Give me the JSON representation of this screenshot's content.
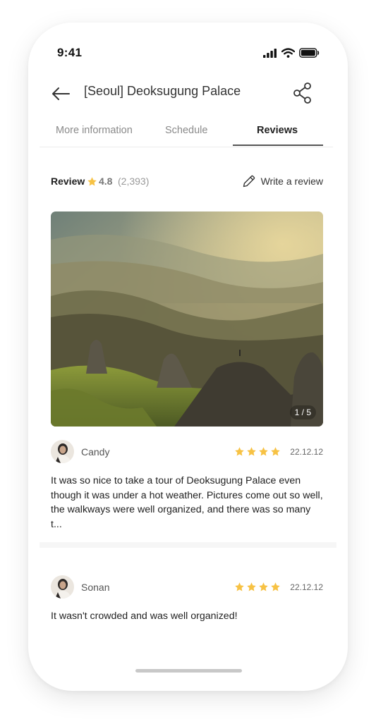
{
  "status_bar": {
    "time": "9:41"
  },
  "header": {
    "title": "[Seoul] Deoksugung Palace"
  },
  "tabs": [
    {
      "label": "More information",
      "active": false
    },
    {
      "label": "Schedule",
      "active": false
    },
    {
      "label": "Reviews",
      "active": true
    }
  ],
  "review_summary": {
    "label": "Review",
    "score": "4.8",
    "count": "(2,393)",
    "write_label": "Write a review"
  },
  "photo": {
    "counter": "1 / 5"
  },
  "reviews": [
    {
      "name": "Candy",
      "rating": 4,
      "date": "22.12.12",
      "text": "It was so nice to take a tour of Deoksugung Palace even though it was under a hot weather. Pictures come out so well, the walkways were well organized, and there was so many t..."
    },
    {
      "name": "Sonan",
      "rating": 4,
      "date": "22.12.12",
      "text": "It wasn't crowded and was well organized!"
    }
  ],
  "colors": {
    "star": "#F7C244",
    "active_tab": "#222222",
    "inactive_tab": "#8A8A8A"
  },
  "icons": [
    "back-arrow-icon",
    "share-icon",
    "pencil-icon",
    "star-icon",
    "signal-icon",
    "wifi-icon",
    "battery-icon"
  ]
}
